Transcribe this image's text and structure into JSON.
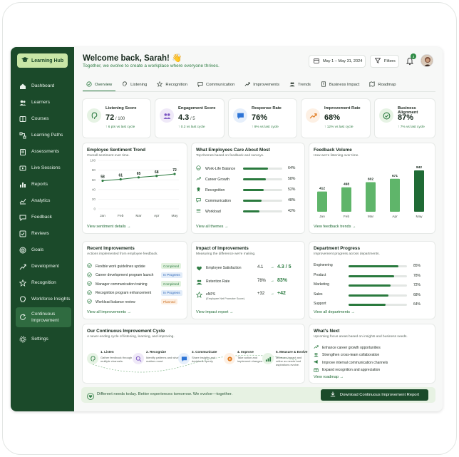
{
  "sidebar": {
    "logo": "Learning Hub",
    "items": [
      {
        "label": "Dashboard",
        "icon": "home-icon"
      },
      {
        "label": "Learners",
        "icon": "users-icon"
      },
      {
        "label": "Courses",
        "icon": "book-icon"
      },
      {
        "label": "Learning Paths",
        "icon": "path-icon"
      },
      {
        "label": "Assessments",
        "icon": "clipboard-icon"
      },
      {
        "label": "Live Sessions",
        "icon": "video-icon"
      },
      {
        "label": "Reports",
        "icon": "bar-chart-icon"
      },
      {
        "label": "Analytics",
        "icon": "line-chart-icon"
      },
      {
        "label": "Feedback",
        "icon": "chat-icon"
      },
      {
        "label": "Reviews",
        "icon": "review-icon"
      },
      {
        "label": "Goals",
        "icon": "target-icon"
      },
      {
        "label": "Development",
        "icon": "growth-icon"
      },
      {
        "label": "Recognition",
        "icon": "star-icon"
      },
      {
        "label": "Workforce Insights",
        "icon": "bulb-icon"
      },
      {
        "label": "Continuous Improvement",
        "icon": "cycle-icon"
      },
      {
        "label": "Settings",
        "icon": "gear-icon"
      }
    ]
  },
  "header": {
    "title": "Welcome back, Sarah! 👋",
    "subtitle": "Together, we evolve to create a workplace where everyone thrives.",
    "date_range": "May 1 – May 31, 2024",
    "filters": "Filters",
    "notif_count": "3"
  },
  "tabs": [
    "Overview",
    "Listening",
    "Recognition",
    "Communication",
    "Improvements",
    "Trends",
    "Business Impact",
    "Roadmap"
  ],
  "kpis": [
    {
      "title": "Listening Score",
      "value": "72",
      "unit": " / 100",
      "delta": "↑ 6 pts vs last cycle"
    },
    {
      "title": "Engagement Score",
      "value": "4.3",
      "unit": " / 5",
      "delta": "↑ 0.2 vs last cycle"
    },
    {
      "title": "Response Rate",
      "value": "76%",
      "unit": "",
      "delta": "↑ 9% vs last cycle"
    },
    {
      "title": "Improvement Rate",
      "value": "68%",
      "unit": "",
      "delta": "↑ 12% vs last cycle"
    },
    {
      "title": "Business Alignment",
      "value": "87%",
      "unit": "",
      "delta": "↑ 7% vs last cycle"
    }
  ],
  "sentiment": {
    "title": "Employee Sentiment Trend",
    "subtitle": "Overall sentiment over time.",
    "link": "View sentiment details  →",
    "yticks": [
      "100",
      "80",
      "60",
      "40",
      "20",
      "0"
    ]
  },
  "themes": {
    "title": "What Employees Care About Most",
    "subtitle": "Top themes based on feedback and surveys.",
    "link": "View all themes  →",
    "items": [
      {
        "label": "Work-Life Balance",
        "pct": "64%",
        "value": 64
      },
      {
        "label": "Career Growth",
        "pct": "58%",
        "value": 58
      },
      {
        "label": "Recognition",
        "pct": "52%",
        "value": 52
      },
      {
        "label": "Communication",
        "pct": "48%",
        "value": 48
      },
      {
        "label": "Workload",
        "pct": "42%",
        "value": 42
      }
    ]
  },
  "volume": {
    "title": "Feedback Volume",
    "subtitle": "How we're listening over time.",
    "link": "View feedback trends  →"
  },
  "recent": {
    "title": "Recent Improvements",
    "subtitle": "Actions implemented from employee feedback.",
    "link": "View all improvements  →",
    "items": [
      {
        "label": "Flexible work guidelines update",
        "status": "Completed"
      },
      {
        "label": "Career development program launch",
        "status": "In Progress"
      },
      {
        "label": "Manager communication training",
        "status": "Completed"
      },
      {
        "label": "Recognition program enhancement",
        "status": "In Progress"
      },
      {
        "label": "Workload balance review",
        "status": "Planned"
      }
    ]
  },
  "impact": {
    "title": "Impact of Improvements",
    "subtitle": "Measuring the difference we're making.",
    "link": "View impact report  →",
    "items": [
      {
        "label": "Employee Satisfaction",
        "sub": "",
        "from": "4.1",
        "to": "4.3 / 5"
      },
      {
        "label": "Retention Rate",
        "sub": "",
        "from": "78%",
        "to": "83%"
      },
      {
        "label": "eNPS",
        "sub": "(Employee Net Promoter Score)",
        "from": "+32",
        "to": "+42"
      }
    ]
  },
  "dept": {
    "title": "Department Progress",
    "subtitle": "Improvement progress across departments.",
    "link": "View all departments  →",
    "items": [
      {
        "label": "Engineering",
        "pct": "85%",
        "value": 85
      },
      {
        "label": "Product",
        "pct": "78%",
        "value": 78
      },
      {
        "label": "Marketing",
        "pct": "72%",
        "value": 72
      },
      {
        "label": "Sales",
        "pct": "68%",
        "value": 68
      },
      {
        "label": "Support",
        "pct": "64%",
        "value": 64
      }
    ]
  },
  "cycle": {
    "title": "Our Continuous Improvement Cycle",
    "subtitle": "A never-ending cycle of listening, learning, and improving.",
    "steps": [
      {
        "title": "1. Listen",
        "desc": "Gather feedback through multiple channels."
      },
      {
        "title": "2. Recognize",
        "desc": "Identify patterns and what matters most."
      },
      {
        "title": "3. Communicate",
        "desc": "Share insights and decisions openly."
      },
      {
        "title": "4. Improve",
        "desc": "Take action and implement changes."
      },
      {
        "title": "5. Measure & Evolve",
        "desc": "Measure impact and refine as needs and aspirations evolve."
      }
    ]
  },
  "next": {
    "title": "What's Next",
    "subtitle": "Upcoming focus areas based on insights and business needs.",
    "link": "View roadmap  →",
    "items": [
      "Enhance career growth opportunities",
      "Strengthen cross-team collaboration",
      "Improve internal communication channels",
      "Expand recognition and appreciation"
    ]
  },
  "footer": {
    "text": "Different needs today. Better experiences tomorrow. We evolve—together.",
    "button": "Download Continuous Improvement Report"
  },
  "chart_data": [
    {
      "type": "line",
      "title": "Employee Sentiment Trend",
      "categories": [
        "Jan",
        "Feb",
        "Mar",
        "Apr",
        "May"
      ],
      "values": [
        58,
        61,
        65,
        68,
        72
      ],
      "ylim": [
        0,
        100
      ]
    },
    {
      "type": "bar",
      "title": "Feedback Volume",
      "categories": [
        "Jan",
        "Feb",
        "Mar",
        "Apr",
        "May"
      ],
      "values": [
        412,
        498,
        602,
        671,
        842
      ]
    }
  ],
  "colors": {
    "brand": "#1b4a2a",
    "accent": "#2f7d44",
    "light": "#c8e6a6"
  }
}
